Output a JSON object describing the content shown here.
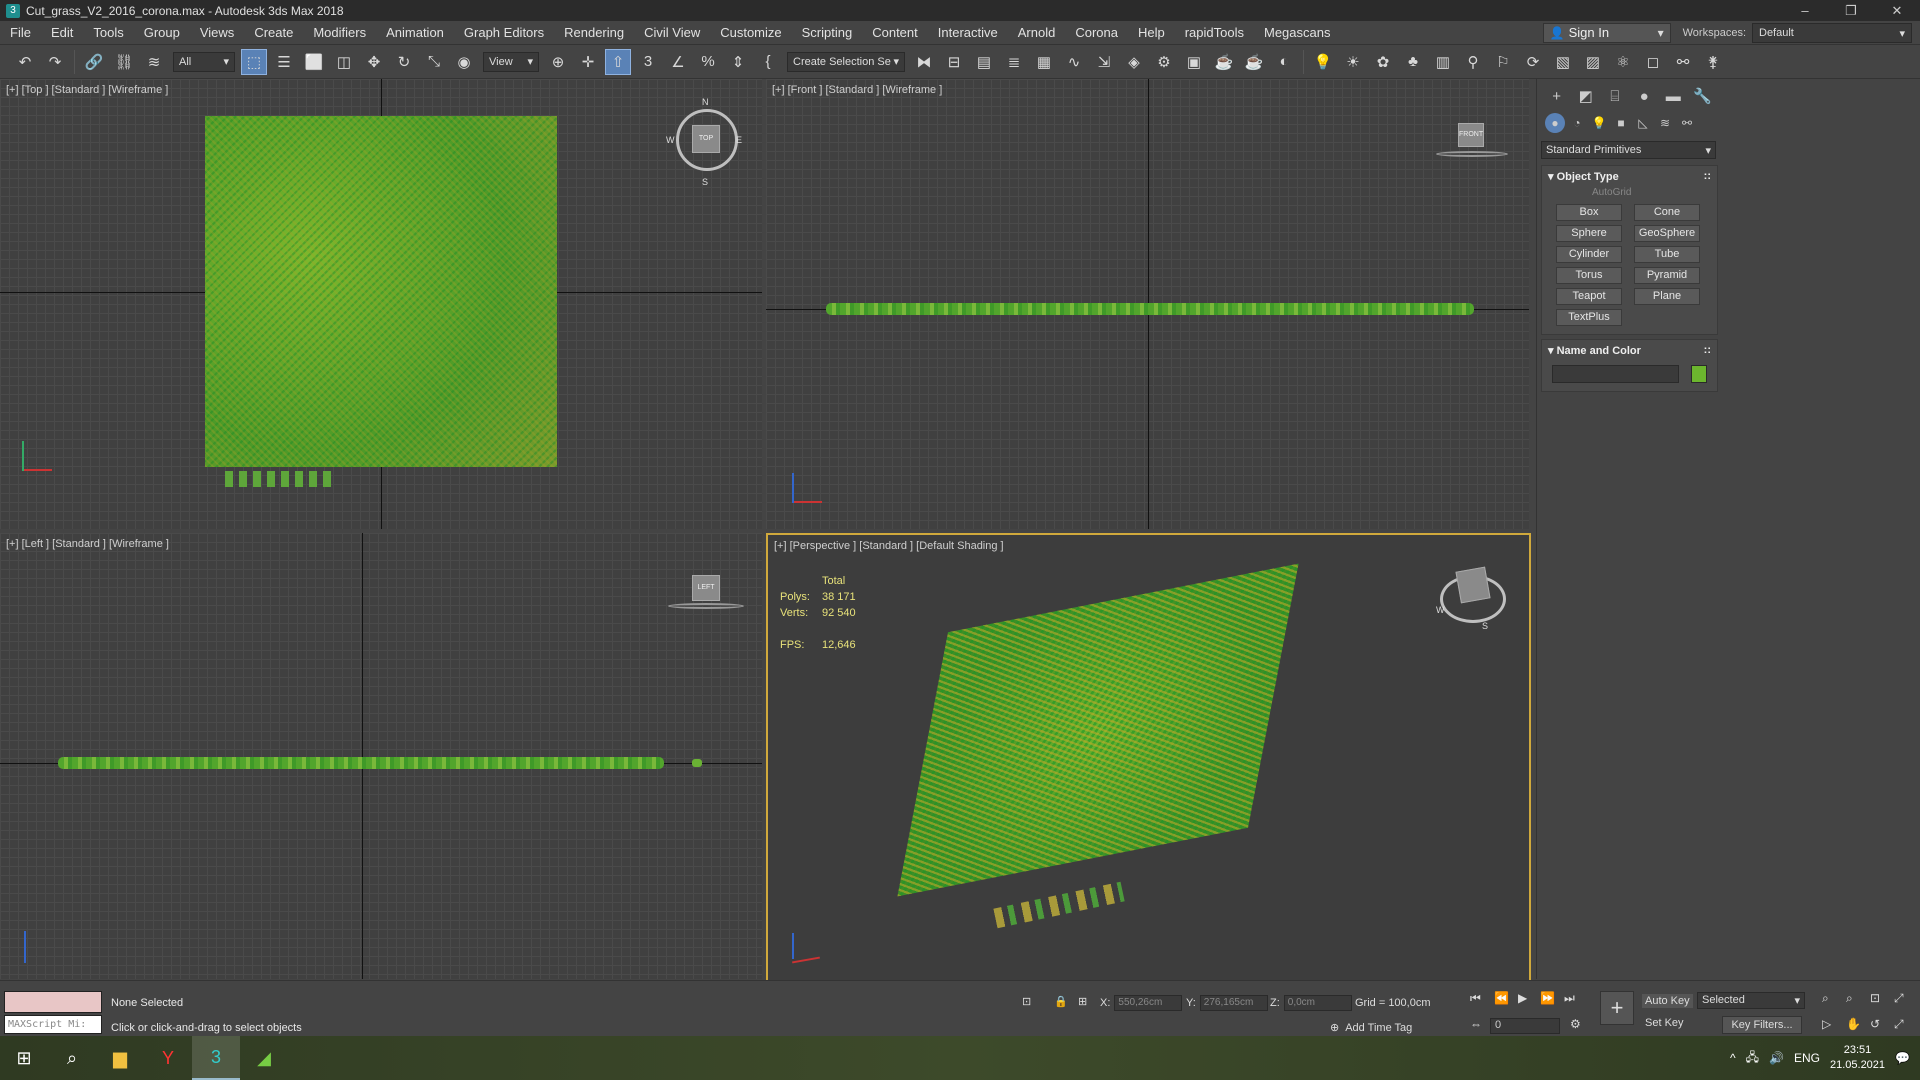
{
  "window": {
    "title": "Cut_grass_V2_2016_corona.max - Autodesk 3ds Max 2018",
    "minimize": "–",
    "restore": "❐",
    "close": "✕"
  },
  "menu": [
    "File",
    "Edit",
    "Tools",
    "Group",
    "Views",
    "Create",
    "Modifiers",
    "Animation",
    "Graph Editors",
    "Rendering",
    "Civil View",
    "Customize",
    "Scripting",
    "Content",
    "Interactive",
    "Arnold",
    "Corona",
    "Help",
    "rapidTools",
    "Megascans"
  ],
  "account": {
    "sign_in": "Sign In",
    "workspaces_label": "Workspaces:",
    "workspace": "Default"
  },
  "toolbar": {
    "filter": "All",
    "ref_coord": "View",
    "selection_set": "Create Selection Se"
  },
  "viewports": {
    "top": {
      "label": "[+] [Top ] [Standard ] [Wireframe ]"
    },
    "front": {
      "label": "[+] [Front ] [Standard ] [Wireframe ]"
    },
    "left": {
      "label": "[+] [Left ] [Standard ] [Wireframe ]"
    },
    "perspective": {
      "label": "[+] [Perspective ] [Standard ] [Default Shading ]"
    }
  },
  "stats": {
    "header": "Total",
    "polys_label": "Polys:",
    "polys": "38 171",
    "verts_label": "Verts:",
    "verts": "92 540",
    "fps_label": "FPS:",
    "fps": "12,646"
  },
  "command_panel": {
    "category": "Standard Primitives",
    "object_type_title": "Object Type",
    "autogrid": "AutoGrid",
    "primitives": [
      "Box",
      "Cone",
      "Sphere",
      "GeoSphere",
      "Cylinder",
      "Tube",
      "Torus",
      "Pyramid",
      "Teapot",
      "Plane",
      "TextPlus"
    ],
    "name_color_title": "Name and Color",
    "swatch_color": "#6cb62e"
  },
  "status": {
    "selection": "None Selected",
    "prompt": "Click or click-and-drag to select objects",
    "maxscript": "MAXScript Mi:",
    "x_label": "X:",
    "x": "550,26cm",
    "y_label": "Y:",
    "y": "276,165cm",
    "z_label": "Z:",
    "z": "0,0cm",
    "grid": "Grid = 100,0cm",
    "add_time_tag": "Add Time Tag",
    "frame": "0",
    "auto_key": "Auto Key",
    "set_key": "Set Key",
    "key_mode": "Selected",
    "key_filters": "Key Filters..."
  },
  "taskbar": {
    "lang": "ENG",
    "time": "23:51",
    "date": "21.05.2021"
  },
  "colors": {
    "accent": "#5a82b6",
    "active_viewport_border": "#d0a93c",
    "grass": "#6cb62e"
  }
}
